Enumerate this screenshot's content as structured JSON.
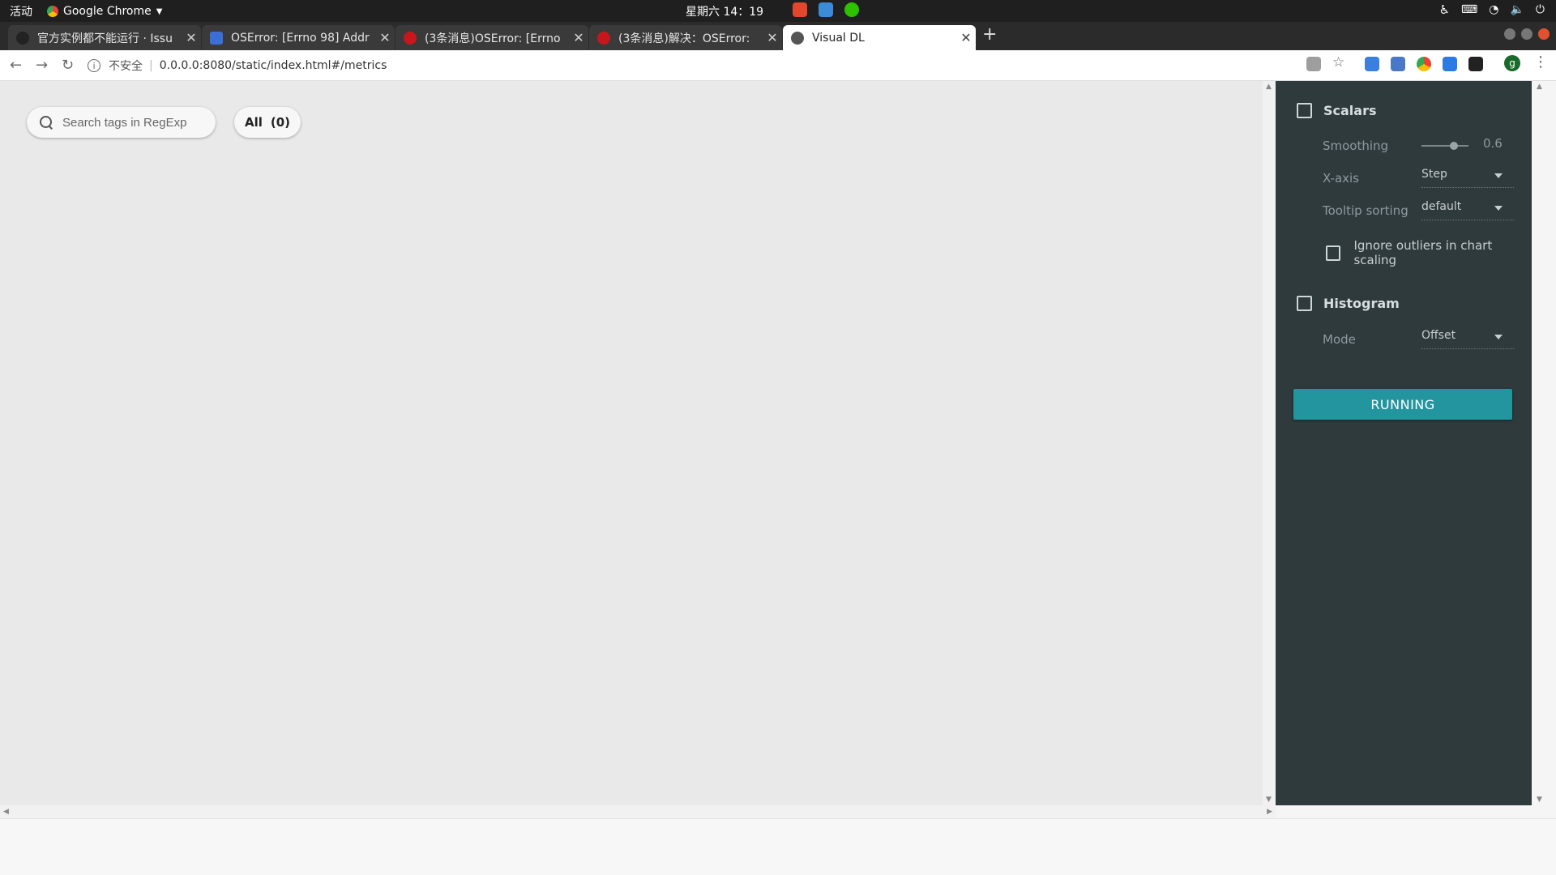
{
  "topbar": {
    "activities": "活动",
    "app_name": "Google Chrome",
    "clock": "星期六 14：19"
  },
  "tabs": [
    {
      "title": "官方实例都不能运行 · Issu",
      "icon_color": "#222222"
    },
    {
      "title": "OSError: [Errno 98] Addr",
      "icon_color": "#3b6fd6"
    },
    {
      "title": "(3条消息)OSError: [Errno",
      "icon_color": "#c8161d"
    },
    {
      "title": "(3条消息)解决：OSError:",
      "icon_color": "#c8161d"
    },
    {
      "title": "Visual DL",
      "icon_color": "#555555"
    }
  ],
  "address_bar": {
    "security_label": "不安全",
    "url": "0.0.0.0:8080/static/index.html#/metrics"
  },
  "main": {
    "search_placeholder": "Search tags in RegExp",
    "all_label": "All",
    "all_count": "(0)"
  },
  "sidebar": {
    "scalars_label": "Scalars",
    "smoothing_label": "Smoothing",
    "smoothing_value": "0.6",
    "xaxis_label": "X-axis",
    "xaxis_value": "Step",
    "tooltip_label": "Tooltip sorting",
    "tooltip_value": "default",
    "ignore_outliers_label": "Ignore outliers in chart scaling",
    "histogram_label": "Histogram",
    "mode_label": "Mode",
    "mode_value": "Offset",
    "running_label": "RUNNING"
  },
  "colors": {
    "sidebar_bg": "#2f3a3d",
    "running_button": "#23959f",
    "page_bg": "#e9e9e9"
  },
  "profile_initial": "g"
}
